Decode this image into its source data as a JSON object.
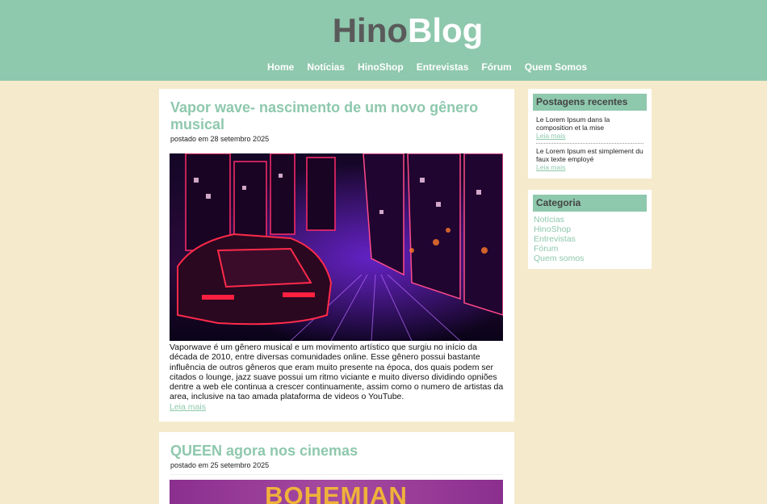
{
  "header": {
    "logo_part1": "Hino",
    "logo_part2": "Blog",
    "nav": [
      "Home",
      "Notícias",
      "HinoShop",
      "Entrevistas",
      "Fórum",
      "Quem Somos"
    ]
  },
  "posts": [
    {
      "title": "Vapor wave- nascimento de um novo gênero musical",
      "date": "postado em 28 setembro 2025",
      "body": "Vaporwave é um gênero musical e um movimento artístico que surgiu no início da década de 2010, entre diversas comunidades online. Esse gênero possui bastante influência de outros gêneros que eram muito presente na época, dos quais podem ser citados o lounge, jazz suave possui um ritmo viciante e muito diverso dividindo opniões dentre a web ele continua a crescer continuamente, assim como o numero de artistas da area, inclusive na tao amada plataforma de videos o YouTube.",
      "read_more": "Leia mais"
    },
    {
      "title": "QUEEN agora nos cinemas",
      "date": "postado em 25 setembro 2025",
      "image_text": "BOHEMIAN"
    }
  ],
  "sidebar": {
    "recent": {
      "title": "Postagens recentes",
      "items": [
        {
          "text": "Le Lorem Ipsum dans la composition et la mise",
          "more": "Leia mais"
        },
        {
          "text": "Le Lorem Ipsum est simplement du faux texte employé",
          "more": "Leia mais"
        }
      ]
    },
    "category": {
      "title": "Categoria",
      "items": [
        "Notícias",
        "HinoShop",
        "Entrevistas",
        "Fórum",
        "Quem somos"
      ]
    }
  },
  "colors": {
    "accent": "#8ec8ad",
    "background": "#f5ebcc",
    "logo_dark": "#5a5a5a"
  }
}
